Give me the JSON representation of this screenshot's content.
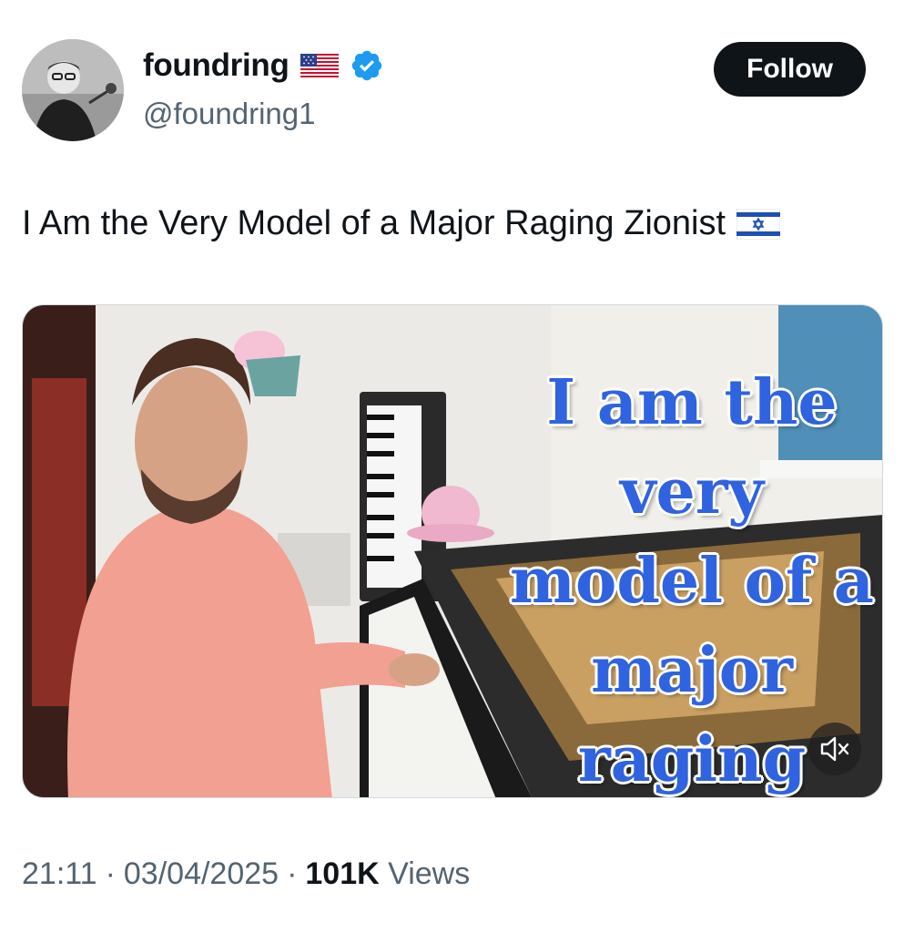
{
  "author": {
    "display_name": "foundring",
    "handle": "@foundring1",
    "verified": true,
    "flag": "us-flag-emoji"
  },
  "follow_button": {
    "label": "Follow"
  },
  "tweet": {
    "text": "I Am the Very Model of a Major Raging Zionist",
    "text_emoji": "israel-flag-emoji"
  },
  "media": {
    "overlay_title": "I am the very model of a major raging Zionist",
    "mute_icon": "speaker-muted-icon"
  },
  "meta": {
    "time": "21:11",
    "separator": "·",
    "date": "03/04/2025",
    "views_count": "101K",
    "views_label": "Views"
  },
  "colors": {
    "text_primary": "#0f1419",
    "text_secondary": "#536471",
    "verified_blue": "#1d9bf0",
    "follow_bg": "#0f1419",
    "overlay_text_blue": "#2f63e0"
  }
}
